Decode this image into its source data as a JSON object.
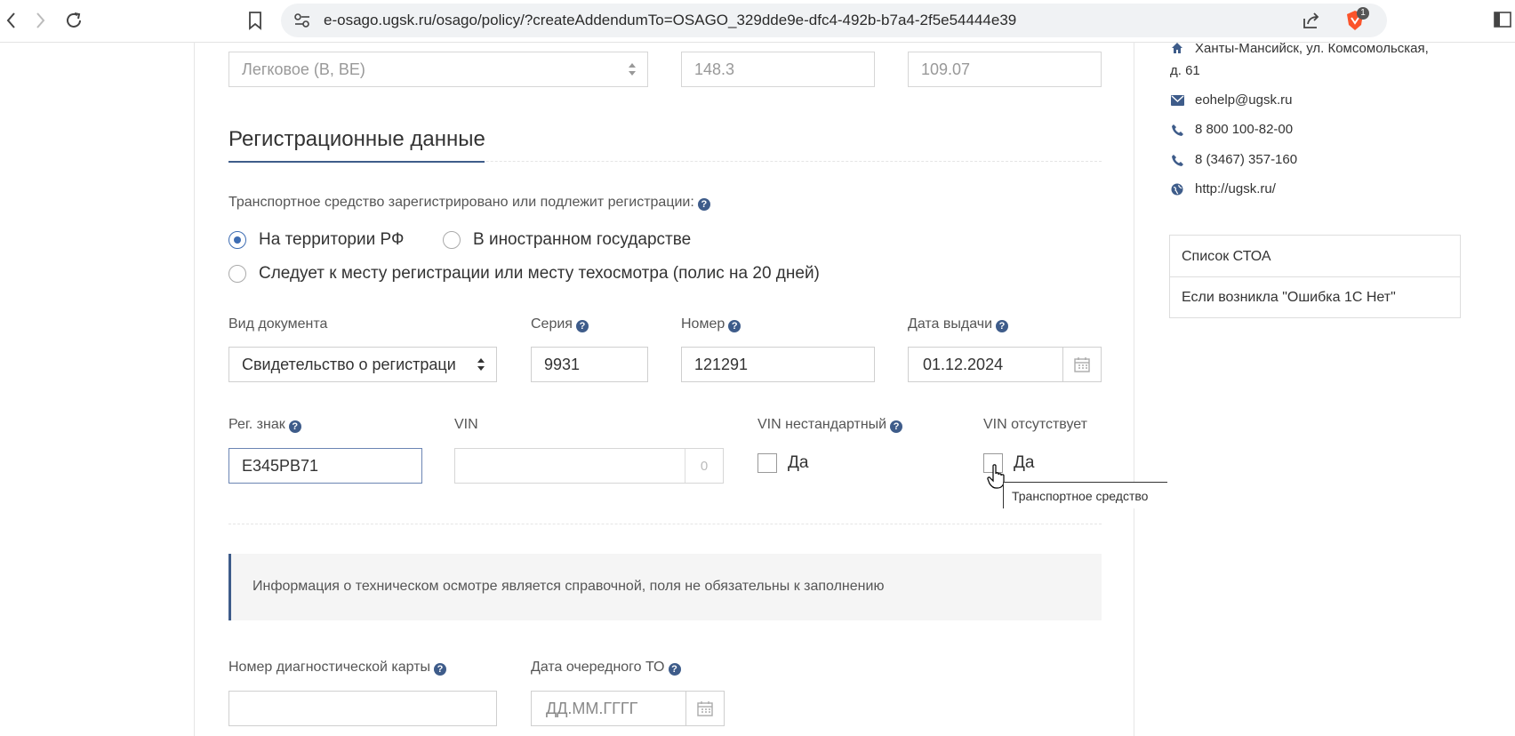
{
  "browser": {
    "url": "e-osago.ugsk.ru/osago/policy/?createAddendumTo=OSAGO_329dde9e-dfc4-492b-b7a4-2f5e54444e39",
    "ext_badge": "1"
  },
  "top_row": {
    "category_select": "Легковое (B, BE)",
    "power_value": "148.3",
    "power_kw_value": "109.07"
  },
  "section": {
    "title": "Регистрационные данные"
  },
  "registration": {
    "question": "Транспортное средство зарегистрировано или подлежит регистрации:",
    "options": [
      "На территории РФ",
      "В иностранном государстве",
      "Следует к месту регистрации или месту техосмотра (полис на 20 дней)"
    ],
    "selected": "На территории РФ"
  },
  "document": {
    "type_label": "Вид документа",
    "type_value": "Свидетельство о регистраци",
    "series_label": "Серия",
    "series_value": "9931",
    "number_label": "Номер",
    "number_value": "121291",
    "date_label": "Дата выдачи",
    "date_value": "01.12.2024"
  },
  "vehicle": {
    "reg_label": "Рег. знак",
    "reg_value": "Е345РВ71",
    "vin_label": "VIN",
    "vin_value": "",
    "vin_counter": "0",
    "vin_nonstd_label": "VIN нестандартный",
    "vin_nonstd_check": "Да",
    "vin_absent_label": "VIN отсутствует",
    "vin_absent_check": "Да",
    "tooltip": "Транспортное средство"
  },
  "inspection": {
    "info": "Информация о техническом осмотре является справочной, поля не обязательны к заполнению",
    "card_label": "Номер диагностической карты",
    "card_value": "",
    "next_to_label": "Дата очередного ТО",
    "next_to_placeholder": "ДД.ММ.ГГГГ"
  },
  "sidebar": {
    "address_line1": "Ханты-Мансийск, ул. Комсомольская,",
    "address_line2": "д. 61",
    "email": "eohelp@ugsk.ru",
    "phone1": "8 800 100-82-00",
    "phone2": "8 (3467) 357-160",
    "site": "http://ugsk.ru/",
    "links": [
      "Список СТОА",
      "Если возникла \"Ошибка 1С Нет\""
    ]
  },
  "colors": {
    "accent": "#3e5c8a",
    "link": "#3e6db3"
  }
}
